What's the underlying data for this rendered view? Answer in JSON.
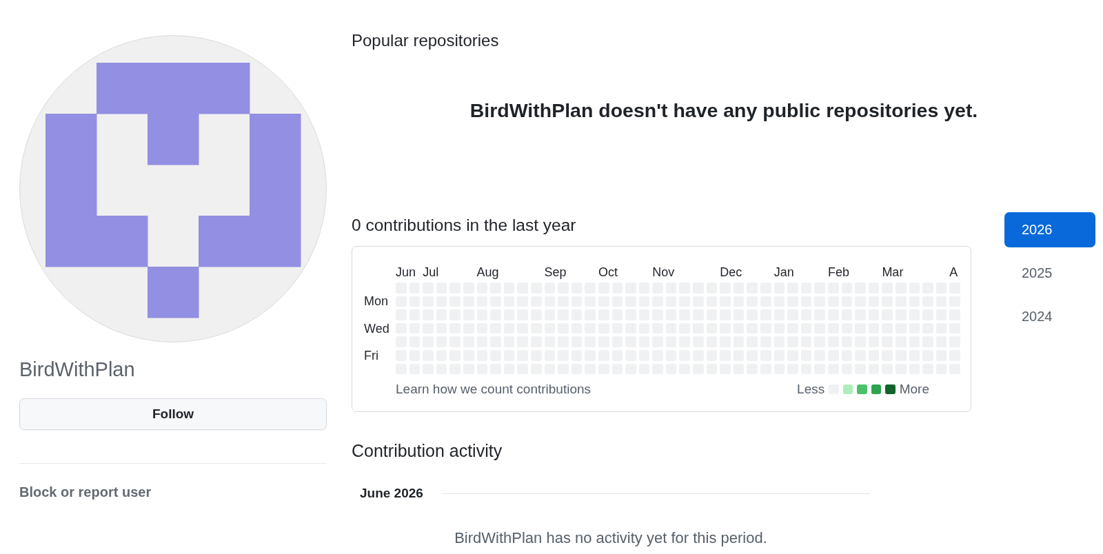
{
  "profile": {
    "name": "BirdWithPlan",
    "follow_button": "Follow",
    "block_link": "Block or report user"
  },
  "popular_repositories": {
    "title": "Popular repositories",
    "empty_message": "BirdWithPlan doesn't have any public repositories yet."
  },
  "contributions": {
    "title": "0 contributions in the last year",
    "months": [
      "Jun",
      "Jul",
      "Aug",
      "Sep",
      "Oct",
      "Nov",
      "Dec",
      "Jan",
      "Feb",
      "Mar",
      "A"
    ],
    "days": [
      "Mon",
      "Wed",
      "Fri"
    ],
    "learn_link": "Learn how we count contributions",
    "legend": {
      "less": "Less",
      "more": "More",
      "levels": [
        {
          "color": "#eff1f3"
        },
        {
          "color": "#aceebb"
        },
        {
          "color": "#4ac26b"
        },
        {
          "color": "#2da44e"
        },
        {
          "color": "#116329"
        }
      ]
    }
  },
  "years": [
    {
      "label": "2026",
      "selected": true
    },
    {
      "label": "2025",
      "selected": false
    },
    {
      "label": "2024",
      "selected": false
    }
  ],
  "activity": {
    "title": "Contribution activity",
    "month": "June 2026",
    "empty_message": "BirdWithPlan has no activity yet for this period."
  }
}
